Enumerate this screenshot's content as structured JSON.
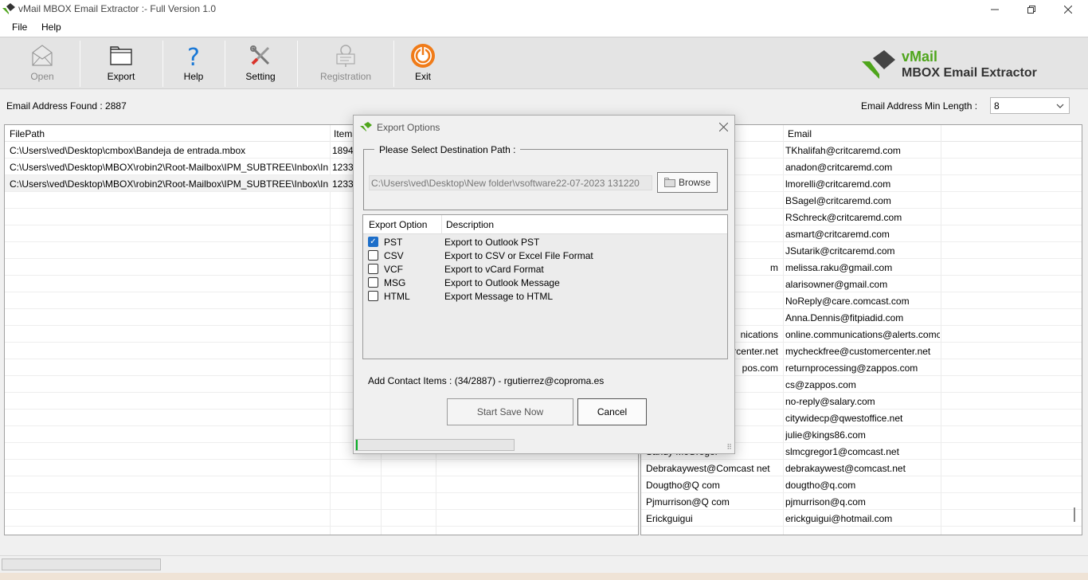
{
  "window": {
    "title": "vMail MBOX Email Extractor :- Full Version 1.0"
  },
  "menu": {
    "file": "File",
    "help": "Help"
  },
  "toolbar": {
    "open": "Open",
    "export": "Export",
    "help": "Help",
    "setting": "Setting",
    "registration": "Registration",
    "exit": "Exit"
  },
  "brand": {
    "name": "vMail",
    "product": "MBOX Email Extractor",
    "color": "#4ea51b"
  },
  "info": {
    "found_label": "Email Address Found :  2887",
    "min_length_label": "Email Address Min Length :",
    "min_length_value": "8"
  },
  "left_grid": {
    "headers": [
      "FilePath",
      "Items"
    ],
    "rows": [
      {
        "path": "C:\\Users\\ved\\Desktop\\cmbox\\Bandeja de entrada.mbox",
        "items": "1894"
      },
      {
        "path": "C:\\Users\\ved\\Desktop\\MBOX\\robin2\\Root-Mailbox\\IPM_SUBTREE\\Inbox\\Inbox...",
        "items": "1233"
      },
      {
        "path": "C:\\Users\\ved\\Desktop\\MBOX\\robin2\\Root-Mailbox\\IPM_SUBTREE\\Inbox\\Inbox...",
        "items": "1233"
      }
    ]
  },
  "right_grid": {
    "headers": [
      "",
      "Email"
    ],
    "rows": [
      {
        "name": "",
        "email": "TKhalifah@critcaremd.com"
      },
      {
        "name": "",
        "email": "anadon@critcaremd.com"
      },
      {
        "name": "",
        "email": "lmorelli@critcaremd.com"
      },
      {
        "name": "",
        "email": "BSagel@critcaremd.com"
      },
      {
        "name": "",
        "email": "RSchreck@critcaremd.com"
      },
      {
        "name": "",
        "email": "asmart@critcaremd.com"
      },
      {
        "name": "",
        "email": "JSutarik@critcaremd.com"
      },
      {
        "name": "m",
        "email": "melissa.raku@gmail.com"
      },
      {
        "name": "",
        "email": "alarisowner@gmail.com"
      },
      {
        "name": "",
        "email": "NoReply@care.comcast.com"
      },
      {
        "name": "",
        "email": "Anna.Dennis@fitpiadid.com"
      },
      {
        "name": "nications",
        "email": "online.communications@alerts.comca..."
      },
      {
        "name": "ercenter.net",
        "email": "mycheckfree@customercenter.net"
      },
      {
        "name": "pos.com",
        "email": "returnprocessing@zappos.com"
      },
      {
        "name": "",
        "email": "cs@zappos.com"
      },
      {
        "name": "",
        "email": "no-reply@salary.com"
      },
      {
        "name": "",
        "email": "citywidecp@qwestoffice.net"
      },
      {
        "name": "",
        "email": "julie@kings86.com"
      },
      {
        "name": "Sandy McGregor",
        "email": "slmcgregor1@comcast.net"
      },
      {
        "name": "Debrakaywest@Comcast net",
        "email": "debrakaywest@comcast.net"
      },
      {
        "name": "Dougtho@Q com",
        "email": "dougtho@q.com"
      },
      {
        "name": "Pjmurrison@Q com",
        "email": "pjmurrison@q.com"
      },
      {
        "name": "Erickguigui",
        "email": "erickguigui@hotmail.com"
      }
    ]
  },
  "dialog": {
    "title": "Export Options",
    "dest_legend": "Please Select Destination Path :",
    "dest_path": "C:\\Users\\ved\\Desktop\\New folder\\vsoftware22-07-2023 131220",
    "browse": "Browse",
    "col_option": "Export Option",
    "col_description": "Description",
    "options": [
      {
        "name": "PST",
        "desc": "Export to Outlook PST",
        "checked": true
      },
      {
        "name": "CSV",
        "desc": "Export to CSV or Excel File Format",
        "checked": false
      },
      {
        "name": "VCF",
        "desc": "Export to vCard Format",
        "checked": false
      },
      {
        "name": "MSG",
        "desc": "Export to Outlook Message",
        "checked": false
      },
      {
        "name": "HTML",
        "desc": "Export Message to HTML",
        "checked": false
      }
    ],
    "contact_status": "Add Contact Items : (34/2887) - rgutierrez@coproma.es",
    "start": "Start Save Now",
    "cancel": "Cancel",
    "progress": 0.01,
    "progress_color": "#06b025"
  }
}
